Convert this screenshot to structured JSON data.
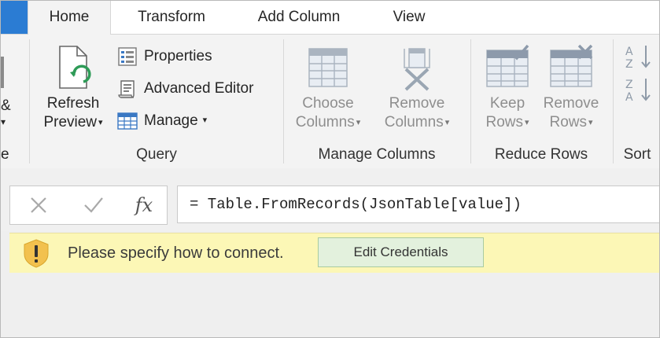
{
  "tabs": [
    {
      "label": "Home",
      "active": true
    },
    {
      "label": "Transform"
    },
    {
      "label": "Add Column"
    },
    {
      "label": "View"
    }
  ],
  "ribbon": {
    "left_cut": {
      "text_amp": "&",
      "text_caret": "▾",
      "text_e": "e"
    },
    "query": {
      "label": "Query",
      "refresh_preview": {
        "line1": "Refresh",
        "line2": "Preview",
        "caret": "▾"
      },
      "properties": "Properties",
      "advanced_editor": "Advanced Editor",
      "manage": "Manage",
      "manage_caret": "▾"
    },
    "manage_columns": {
      "label": "Manage Columns",
      "choose_columns": {
        "line1": "Choose",
        "line2": "Columns",
        "caret": "▾"
      },
      "remove_columns": {
        "line1": "Remove",
        "line2": "Columns",
        "caret": "▾"
      }
    },
    "reduce_rows": {
      "label": "Reduce Rows",
      "keep_rows": {
        "line1": "Keep",
        "line2": "Rows",
        "caret": "▾"
      },
      "remove_rows": {
        "line1": "Remove",
        "line2": "Rows",
        "caret": "▾"
      }
    },
    "sort": {
      "label": "Sort"
    }
  },
  "formula_bar": {
    "cancel_icon": "close-icon",
    "commit_icon": "check-icon",
    "fx_label": "fx",
    "formula": "= Table.FromRecords(JsonTable[value])"
  },
  "warning": {
    "message": "Please specify how to connect.",
    "button": "Edit Credentials",
    "colors": {
      "background": "#fcf7b6",
      "icon": "#f2c14e",
      "button_bg": "#e3f1dd"
    }
  },
  "colors": {
    "accent": "#2b7cd3",
    "ribbon_bg": "#f3f3f3"
  }
}
